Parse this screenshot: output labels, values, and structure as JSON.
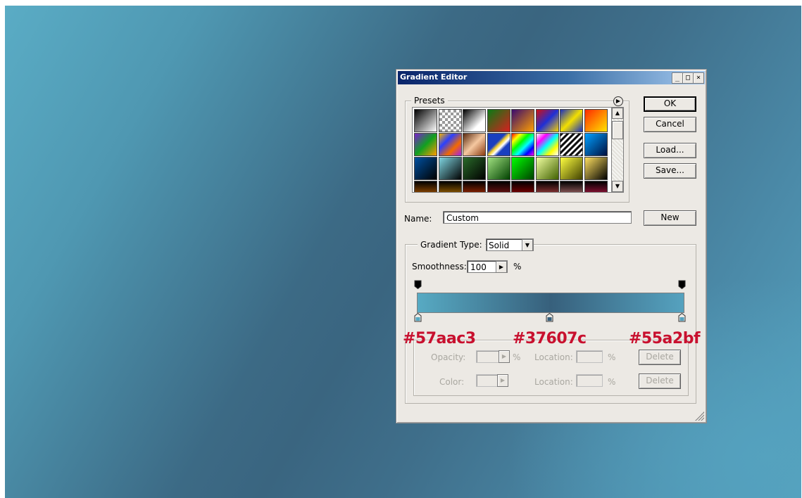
{
  "window": {
    "title": "Gradient Editor",
    "controls": {
      "minimize": "_",
      "maximize": "□",
      "close": "×"
    }
  },
  "presets": {
    "label": "Presets",
    "menu_icon": "circle-arrow-icon",
    "swatches": [
      {
        "bg": "linear-gradient(135deg,#000,#fff)"
      },
      {
        "bg": "repeating-conic-gradient(#999 0 25%, #fff 0 50%) 0 0/8px 8px"
      },
      {
        "bg": "linear-gradient(135deg,#000,#fff 70%)"
      },
      {
        "bg": "linear-gradient(135deg,#0a7a14,#d81f1f)"
      },
      {
        "bg": "linear-gradient(135deg,#3a0a6e,#ffa000)"
      },
      {
        "bg": "linear-gradient(135deg,#d01010,#1f2fd6,#f5d000)"
      },
      {
        "bg": "linear-gradient(135deg,#1a2fbf,#f3e000,#1a2fbf)"
      },
      {
        "bg": "linear-gradient(135deg,#ff2a00,#ffe400)"
      },
      {
        "bg": "linear-gradient(135deg,#7a1fcf,#10a020,#ff9a00)"
      },
      {
        "bg": "linear-gradient(135deg,#f3b000,#2a40ff,#f36a00,#a020f0)"
      },
      {
        "bg": "linear-gradient(135deg,#5a2a10,#f5c8a0,#8a3a10)"
      },
      {
        "bg": "linear-gradient(135deg,#1a3fbf 40%,#f4d030 50%,#ffffff 60%,#1a3fbf 70%)"
      },
      {
        "bg": "linear-gradient(135deg,#f00,#ff0,#0f0,#0ff,#00f,#f0f)"
      },
      {
        "bg": "linear-gradient(135deg,#fff,#f0f,#0ff,#ff0,#fff)"
      },
      {
        "bg": "repeating-linear-gradient(135deg,#111 0 3px,#fff 3px 6px)"
      },
      {
        "bg": "linear-gradient(135deg,#00a0ff,#001040)"
      },
      {
        "bg": "linear-gradient(135deg,#0050a0,#000)"
      },
      {
        "bg": "linear-gradient(135deg,#7fd4e0,#000)"
      },
      {
        "bg": "linear-gradient(135deg,#2a6a2a,#000)"
      },
      {
        "bg": "linear-gradient(135deg,#a0e080,#004000)"
      },
      {
        "bg": "linear-gradient(135deg,#00ff00,#004000)"
      },
      {
        "bg": "linear-gradient(135deg,#f0ffa0,#406000)"
      },
      {
        "bg": "linear-gradient(135deg,#ffff40,#404000)"
      },
      {
        "bg": "linear-gradient(135deg,#ffe060,#000)"
      },
      {
        "bg": "linear-gradient(180deg,#000,#ff8000)"
      },
      {
        "bg": "linear-gradient(180deg,#000,#ffa000)"
      },
      {
        "bg": "linear-gradient(180deg,#000,#ff4000)"
      },
      {
        "bg": "linear-gradient(180deg,#000,#c02020)"
      },
      {
        "bg": "linear-gradient(180deg,#000,#e00000)"
      },
      {
        "bg": "linear-gradient(180deg,#000,#ff6060)"
      },
      {
        "bg": "linear-gradient(180deg,#000,#ffa0a0)"
      },
      {
        "bg": "linear-gradient(180deg,#000,#ff2060)"
      }
    ]
  },
  "buttons": {
    "ok": "OK",
    "cancel": "Cancel",
    "load": "Load...",
    "save": "Save...",
    "new": "New",
    "delete": "Delete"
  },
  "name_row": {
    "label": "Name:",
    "value": "Custom"
  },
  "gradient_type": {
    "label": "Gradient Type:",
    "value": "Solid"
  },
  "smoothness": {
    "label": "Smoothness:",
    "value": "100",
    "unit": "%"
  },
  "gradient": {
    "css": "linear-gradient(90deg,#57aac3 0%,#37607c 50%,#55a2bf 100%)",
    "color_stops": [
      "#57aac3",
      "#37607c",
      "#55a2bf"
    ],
    "stop_positions_percent": [
      0,
      50,
      100
    ]
  },
  "annotations": [
    "#57aac3",
    "#37607c",
    "#55a2bf"
  ],
  "stops_group": {
    "opacity_label": "Opacity:",
    "opacity_unit": "%",
    "location_label": "Location:",
    "location_unit": "%",
    "color_label": "Color:"
  },
  "colors": {
    "annotation": "#c8102e",
    "titlebar_start": "#0a246a",
    "dialog_bg": "#ece9e4"
  }
}
